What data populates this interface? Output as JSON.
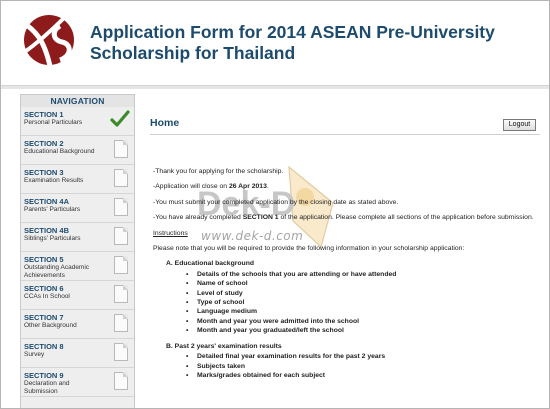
{
  "header": {
    "title_line1": "Application Form for 2014 ASEAN Pre-University",
    "title_line2": "Scholarship for Thailand"
  },
  "sidebar": {
    "heading": "NAVIGATION",
    "items": [
      {
        "section": "SECTION 1",
        "label": "Personal Particulars",
        "status_icon": "check-icon"
      },
      {
        "section": "SECTION 2",
        "label": "Educational Background",
        "status_icon": "document-icon"
      },
      {
        "section": "SECTION 3",
        "label": "Examination Results",
        "status_icon": "document-icon"
      },
      {
        "section": "SECTION 4A",
        "label": "Parents' Particulars",
        "status_icon": "document-icon"
      },
      {
        "section": "SECTION 4B",
        "label": "Siblings' Particulars",
        "status_icon": "document-icon"
      },
      {
        "section": "SECTION 5",
        "label": "Outstanding Academic",
        "label2": "Achievements",
        "status_icon": "document-icon"
      },
      {
        "section": "SECTION 6",
        "label": "CCAs In School",
        "status_icon": "document-icon"
      },
      {
        "section": "SECTION 7",
        "label": "Other Background",
        "status_icon": "document-icon"
      },
      {
        "section": "SECTION 8",
        "label": "Survey",
        "status_icon": "document-icon"
      },
      {
        "section": "SECTION 9",
        "label": "Declaration and",
        "label2": "Submission",
        "status_icon": "document-icon"
      }
    ]
  },
  "main": {
    "title": "Home",
    "logout_label": "Logout",
    "messages": {
      "thanks": "-Thank you for applying for the scholarship.",
      "close_prefix": "-Application will close on ",
      "close_date": "26 Apr 2013",
      "close_suffix": ".",
      "submit": "-You must submit your completed application by the closing date as stated above.",
      "completed_prefix": "-You have already completed ",
      "completed_section": "SECTION 1",
      "completed_suffix": " of the application. Please complete all sections of the application before submission."
    },
    "instructions_heading": "Instructions",
    "instructions_text": "Please note that you will be required to provide the following information in your scholarship application:",
    "sections": [
      {
        "heading": "A.  Educational background",
        "items": [
          "Details of the schools that you are attending or have attended",
          "Name of school",
          "Level of study",
          "Type of school",
          "Language medium",
          "Month and year you were admitted into the school",
          "Month and year you graduated/left the school"
        ]
      },
      {
        "heading": "B.  Past 2 years' examination results",
        "items": [
          "Detailed final year examination results for the past 2 years",
          "Subjects taken",
          "Marks/grades obtained for each subject"
        ]
      }
    ]
  },
  "watermark": {
    "logo_text": "Dek-D",
    "url_text": "www.dek-d.com"
  },
  "colors": {
    "brand_blue": "#1d4b6e",
    "logo_red": "#8e1b1b",
    "check_green": "#3d8a2a"
  }
}
